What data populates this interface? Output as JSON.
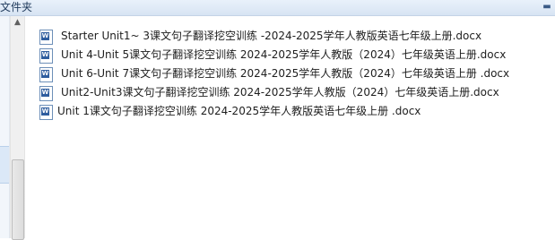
{
  "window": {
    "title": "文件夹"
  },
  "files": [
    {
      "name": "Starter Unit1~ 3课文句子翻译挖空训练 -2024-2025学年人教版英语七年级上册.docx",
      "icon": "word-doc-icon"
    },
    {
      "name": "Unit 4-Unit 5课文句子翻译挖空训练  2024-2025学年人教版（2024）七年级英语上册.docx",
      "icon": "word-doc-icon"
    },
    {
      "name": "Unit 6-Unit 7课文句子翻译挖空训练  2024-2025学年人教版（2024）七年级英语上册  .docx",
      "icon": "word-doc-icon"
    },
    {
      "name": "Unit2-Unit3课文句子翻译挖空训练  2024-2025学年人教版（2024）七年级英语上册.docx",
      "icon": "word-doc-icon"
    },
    {
      "name": "Unit 1课文句子翻译挖空训练 2024-2025学年人教版英语七年级上册 .docx",
      "icon": "word-doc-icon"
    }
  ]
}
